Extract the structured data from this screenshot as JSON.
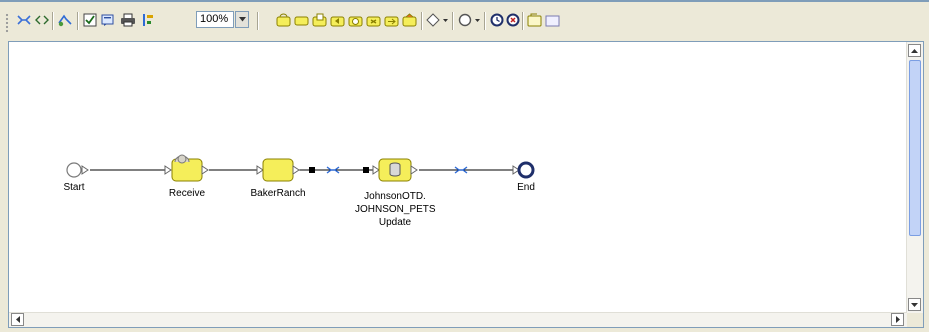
{
  "toolbar": {
    "zoom_value": "100%",
    "icons": [
      "select-icon",
      "code-icon",
      "rebuild-icon",
      "validate-icon",
      "properties-icon",
      "print-icon",
      "align-icon",
      "receive-activity-icon",
      "assign-activity-icon",
      "invoke-activity-icon",
      "reply-activity-icon",
      "wait-activity-icon",
      "throw-activity-icon",
      "compensate-activity-icon",
      "empty-activity-icon",
      "decision-icon",
      "event-icon",
      "timer-icon",
      "terminate-icon",
      "scope-icon",
      "while-icon"
    ]
  },
  "diagram": {
    "nodes": [
      {
        "id": "start",
        "label": "Start",
        "kind": "start"
      },
      {
        "id": "receive",
        "label": "Receive",
        "kind": "activity"
      },
      {
        "id": "bakerranch",
        "label": "BakerRanch",
        "kind": "activity"
      },
      {
        "id": "johnsonotd",
        "label_lines": [
          "JohnsonOTD.",
          "JOHNSON_PETS",
          "Update"
        ],
        "kind": "database-activity"
      },
      {
        "id": "end",
        "label": "End",
        "kind": "end"
      }
    ],
    "links": [
      "start-receive",
      "receive-bakerranch",
      "bakerranch-johnsonotd",
      "johnsonotd-end"
    ]
  },
  "colors": {
    "activity_fill": "#f5ee5a",
    "activity_border": "#8a8000",
    "link": "#000000",
    "mapper": "#2f6bd6",
    "end": "#1f2f6a"
  }
}
